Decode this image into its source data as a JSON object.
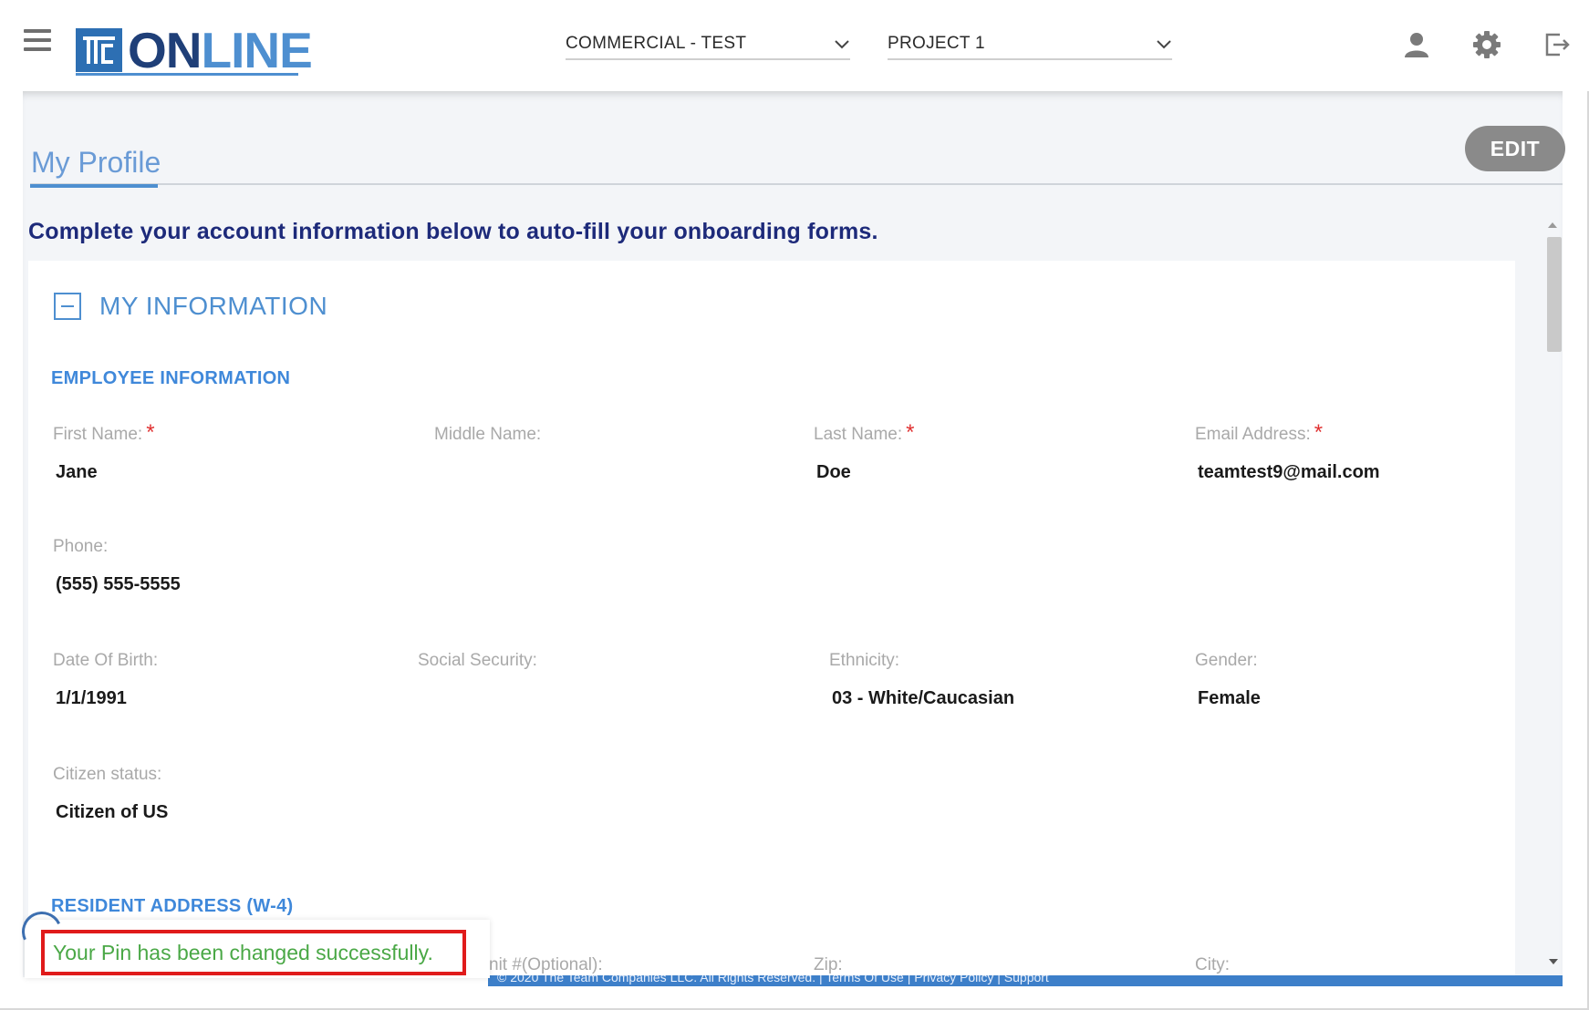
{
  "header": {
    "logo_text_on": "ON",
    "logo_text_line": "LINE",
    "company_select": "COMMERCIAL - TEST",
    "project_select": "PROJECT 1",
    "icons": [
      "menu-icon",
      "user-icon",
      "gear-icon",
      "logout-icon"
    ]
  },
  "page": {
    "tab_title": "My Profile",
    "edit_label": "EDIT",
    "intro": "Complete your account information below to auto-fill your onboarding forms."
  },
  "section": {
    "title": "MY INFORMATION",
    "employee_heading": "EMPLOYEE INFORMATION",
    "fields": {
      "first_name": {
        "label": "First Name:",
        "value": "Jane",
        "required": "*"
      },
      "middle_name": {
        "label": "Middle Name:",
        "value": ""
      },
      "last_name": {
        "label": "Last Name:",
        "value": "Doe",
        "required": "*"
      },
      "email": {
        "label": "Email Address:",
        "value": "teamtest9@mail.com",
        "required": "*"
      },
      "phone": {
        "label": "Phone:",
        "value": "(555) 555-5555"
      },
      "dob": {
        "label": "Date Of Birth:",
        "value": "1/1/1991"
      },
      "ssn": {
        "label": "Social Security:",
        "value": ""
      },
      "ethnicity": {
        "label": "Ethnicity:",
        "value": "03 - White/Caucasian"
      },
      "gender": {
        "label": "Gender:",
        "value": "Female"
      },
      "citizen": {
        "label": "Citizen status:",
        "value": "Citizen of US"
      }
    },
    "address_heading": "RESIDENT ADDRESS (W-4)",
    "address_fields": {
      "unit": {
        "label": "nit #(Optional):"
      },
      "zip": {
        "label": "Zip:"
      },
      "city": {
        "label": "City:"
      }
    }
  },
  "footer": {
    "text": "© 2020 The Team Companies LLC. All Rights Reserved. | Terms Of Use | Privacy Policy | Support"
  },
  "toast": {
    "message": "Your Pin has been changed successfully."
  },
  "colors": {
    "brand_dark": "#1f3f78",
    "brand_light": "#4e8fd0",
    "required": "#e03131",
    "toast_text": "#4aa846",
    "toast_highlight": "#e01b1b"
  }
}
